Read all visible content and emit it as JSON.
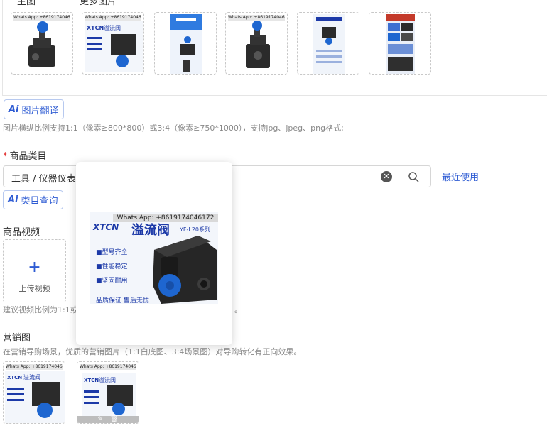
{
  "header": {
    "main_image_label": "主图",
    "more_images_label": "更多图片"
  },
  "watermark": "Whats App: +8619174046172",
  "product": {
    "brand": "XTCN",
    "name": "溢流阀",
    "series": "YF-L20系列",
    "features": [
      "■型号齐全",
      "■性能稳定",
      "■坚固耐用"
    ],
    "slogan": "品质保证 售后无忧"
  },
  "ai_translate": {
    "icon": "Ai",
    "label": "图片翻译"
  },
  "image_hint": "图片横纵比例支持1:1（像素≥800*800）或3:4（像素≥750*1000），支持jpg、jpeg、png格式;",
  "category": {
    "label": "商品类目",
    "value": "工具 / 仪器仪表 /",
    "recent_link": "最近使用",
    "query_icon": "Ai",
    "query_label": "类目查询"
  },
  "video": {
    "label": "商品视频",
    "upload_label": "上传视频",
    "hint_left": "建议视频比例为1:1或",
    "hint_right": "。"
  },
  "marketing": {
    "label": "营销图",
    "hint": "在营销导购场景，优质的营销图片（1:1白底图、3:4场景图）对导购转化有正向效果。"
  },
  "icons": {
    "clear": "clear-circle-icon",
    "search": "search-icon",
    "plus": "plus-icon",
    "edit": "edit-icon",
    "delete": "trash-icon"
  },
  "colors": {
    "accent": "#2d5bd3",
    "required": "#e02020",
    "valve_blue": "#1e66d0"
  }
}
